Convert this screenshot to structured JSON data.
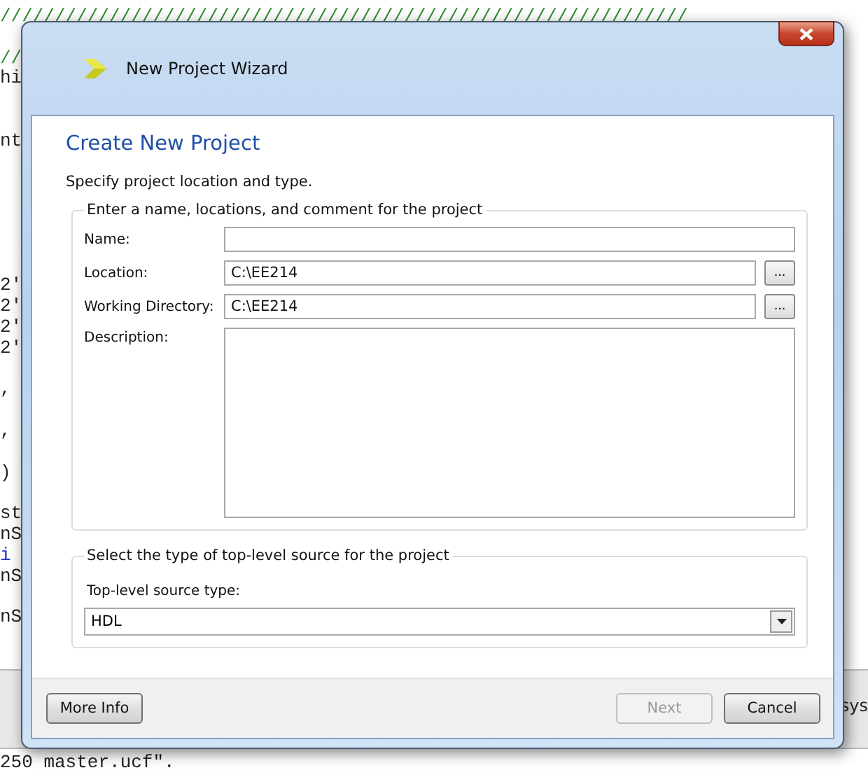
{
  "editor": {
    "lines": [
      {
        "text": "///////////////////////////////////////////////////////////////",
        "kind": "comment"
      },
      {
        "text": "//",
        "kind": "comment"
      },
      {
        "text": "hi",
        "kind": "code"
      },
      {
        "text": "nt",
        "kind": "code"
      },
      {
        "text": "2'",
        "kind": "code"
      },
      {
        "text": "2'",
        "kind": "code"
      },
      {
        "text": "2'",
        "kind": "code"
      },
      {
        "text": "2'",
        "kind": "code"
      },
      {
        "text": ",",
        "kind": "code"
      },
      {
        "text": ",",
        "kind": "code"
      },
      {
        "text": ")",
        "kind": "code"
      },
      {
        "text": "st",
        "kind": "code"
      },
      {
        "text": "nS",
        "kind": "code"
      },
      {
        "text": "i",
        "kind": "keyword"
      },
      {
        "text": "nS",
        "kind": "code"
      },
      {
        "text": "nS",
        "kind": "code"
      },
      {
        "text": "250 master.ucf\".",
        "kind": "code"
      }
    ],
    "side_text": "sys"
  },
  "window": {
    "title": "New Project Wizard"
  },
  "page": {
    "heading": "Create New Project",
    "subtitle": "Specify project location and type."
  },
  "project_group": {
    "legend": "Enter a name, locations, and comment for the project",
    "fields": [
      {
        "label": "Name:",
        "kind": "text"
      },
      {
        "label": "Location:",
        "value": "C:\\EE214",
        "kind": "browse",
        "button": "..."
      },
      {
        "label": "Working Directory:",
        "value": "C:\\EE214",
        "kind": "browse",
        "button": "..."
      },
      {
        "label": "Description:",
        "kind": "multiline"
      }
    ]
  },
  "source_group": {
    "legend": "Select the type of top-level source for the project",
    "label": "Top-level source type:",
    "value": "HDL"
  },
  "buttons": [
    {
      "label": "More Info",
      "disabled": false,
      "kind": "help"
    },
    {
      "label": "Next",
      "disabled": true,
      "kind": "nav"
    },
    {
      "label": "Cancel",
      "disabled": false,
      "kind": "nav"
    }
  ]
}
